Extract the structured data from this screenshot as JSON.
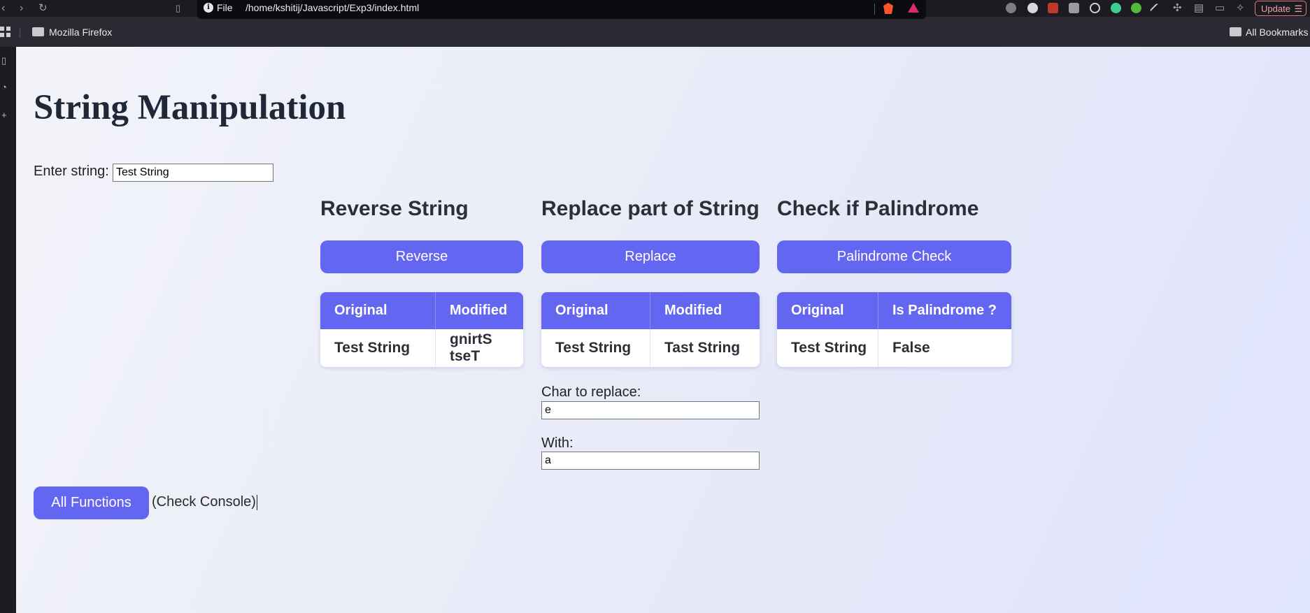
{
  "browser": {
    "url_scheme_label": "File",
    "url_path": "/home/kshitij/Javascript/Exp3/index.html",
    "update_label": "Update",
    "bookmarks_folder": "Mozilla Firefox",
    "all_bookmarks": "All Bookmarks"
  },
  "page": {
    "title": "String Manipulation",
    "enter_label": "Enter string:",
    "input_value": "Test String",
    "sections": [
      {
        "heading": "Reverse String",
        "button": "Reverse",
        "headers": [
          "Original",
          "Modified"
        ],
        "row": [
          "Test String",
          "gnirtS tseT"
        ]
      },
      {
        "heading": "Replace part of String",
        "button": "Replace",
        "headers": [
          "Original",
          "Modified"
        ],
        "row": [
          "Test String",
          "Tast String"
        ],
        "char_label": "Char to replace:",
        "char_value": "e",
        "with_label": "With:",
        "with_value": "a"
      },
      {
        "heading": "Check if Palindrome",
        "button": "Palindrome Check",
        "headers": [
          "Original",
          "Is Palindrome ?"
        ],
        "row": [
          "Test String",
          "False"
        ]
      }
    ],
    "all_functions_button": "All Functions",
    "check_console": "(Check Console)"
  },
  "colors": {
    "accent": "#6366f1",
    "title": "#1f2838"
  }
}
